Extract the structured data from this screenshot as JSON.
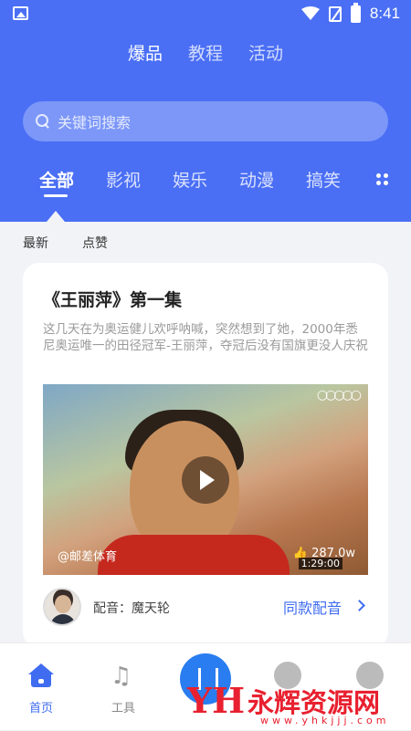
{
  "status_bar": {
    "time": "8:41"
  },
  "top_tabs": [
    {
      "label": "爆品",
      "active": true
    },
    {
      "label": "教程",
      "active": false
    },
    {
      "label": "活动",
      "active": false
    }
  ],
  "search": {
    "placeholder": "关键词搜索"
  },
  "categories": [
    {
      "label": "全部",
      "active": true
    },
    {
      "label": "影视",
      "active": false
    },
    {
      "label": "娱乐",
      "active": false
    },
    {
      "label": "动漫",
      "active": false
    },
    {
      "label": "搞笑",
      "active": false
    }
  ],
  "sort": [
    {
      "label": "最新"
    },
    {
      "label": "点赞"
    }
  ],
  "card": {
    "title": "《王丽萍》第一集",
    "description": "这几天在为奥运健儿欢呼呐喊，突然想到了她，2000年悉尼奥运唯一的田径冠军-王丽萍，夺冠后没有国旗更没人庆祝",
    "video": {
      "watermark": "@邮差体育",
      "likes": "287.0w",
      "duration": "1:29:00",
      "rings": "○○○○○"
    },
    "dubber": "配音：魔天轮",
    "same_dub": "同款配音"
  },
  "bottom_nav": [
    {
      "label": "首页",
      "icon": "home-icon",
      "active": true
    },
    {
      "label": "工具",
      "icon": "music-tool-icon",
      "active": false
    }
  ],
  "overlay": {
    "brand": "永辉资源网",
    "url": "www.yhkjjj.com",
    "mark": "YH"
  },
  "colors": {
    "primary": "#4a6ff5",
    "accent": "#3f6cf0",
    "watermark": "#e8202f"
  }
}
